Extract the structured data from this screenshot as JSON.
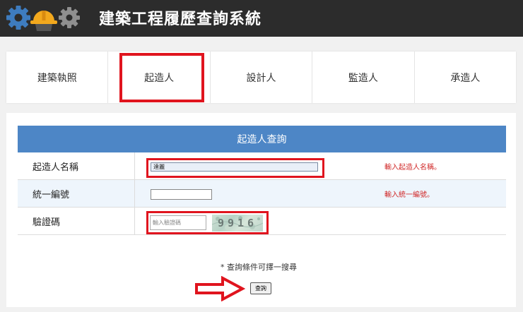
{
  "header": {
    "title": "建築工程履歷查詢系統",
    "logo_icons": [
      "gear-icon",
      "hard-hat-icon",
      "gear-icon"
    ],
    "colors": {
      "background": "#2c2c2c",
      "gear": "#3e7cbf",
      "hard_hat": "#f2a81d"
    }
  },
  "tabs": [
    {
      "label": "建築執照",
      "highlighted": false
    },
    {
      "label": "起造人",
      "highlighted": true
    },
    {
      "label": "設計人",
      "highlighted": false
    },
    {
      "label": "監造人",
      "highlighted": false
    },
    {
      "label": "承造人",
      "highlighted": false
    }
  ],
  "form": {
    "title": "起造人查詢",
    "rows": [
      {
        "label": "起造人名稱",
        "value": "達麗",
        "hint": "輸入起造人名稱。"
      },
      {
        "label": "統一編號",
        "value": "",
        "hint": "輸入統一編號。"
      },
      {
        "label": "驗證碼",
        "placeholder": "輸入驗證碼",
        "captcha_text": "9916"
      }
    ],
    "note": "* 查詢條件可擇一搜尋",
    "submit_label": "查詢"
  },
  "colors": {
    "highlight_box": "#e0141e",
    "form_header": "#4d86c6",
    "hint_text": "#d02828"
  }
}
